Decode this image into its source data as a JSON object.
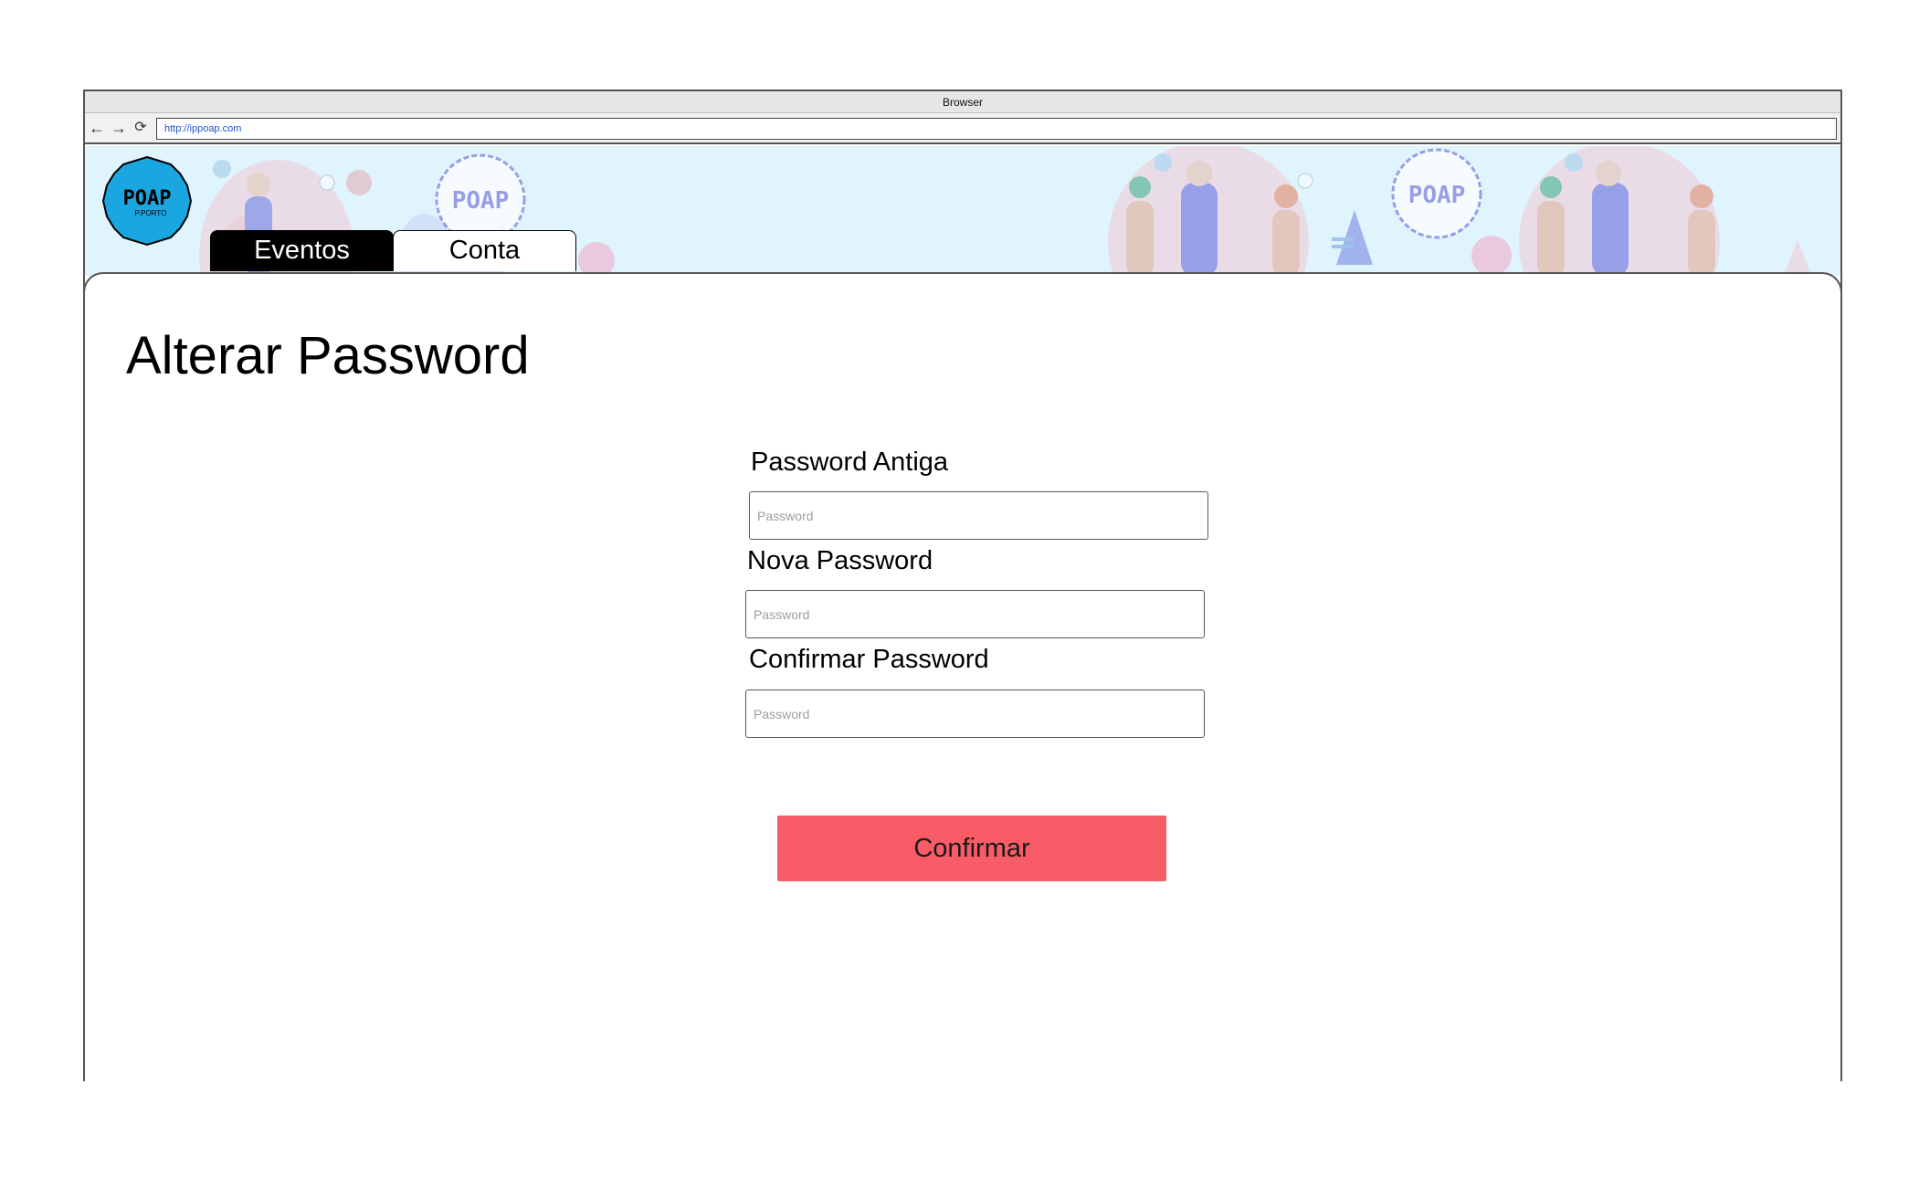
{
  "browser": {
    "title": "Browser",
    "url": "http://ippoap.com",
    "nav": {
      "back_icon": "arrow-left-icon",
      "forward_icon": "arrow-right-icon",
      "reload_icon": "reload-icon"
    }
  },
  "header": {
    "logo": {
      "text": "POAP",
      "subtext": "P.PORTO",
      "color": "#1aa6e0"
    },
    "banner_color": "#dff4fc",
    "tabs": [
      {
        "label": "Eventos",
        "active": true
      },
      {
        "label": "Conta",
        "active": false
      }
    ]
  },
  "main": {
    "title": "Alterar Password",
    "form": {
      "fields": [
        {
          "label": "Password Antiga",
          "placeholder": "Password",
          "value": ""
        },
        {
          "label": "Nova Password",
          "placeholder": "Password",
          "value": ""
        },
        {
          "label": "Confirmar Password",
          "placeholder": "Password",
          "value": ""
        }
      ],
      "submit_label": "Confirmar",
      "submit_color": "#f85c67"
    }
  }
}
